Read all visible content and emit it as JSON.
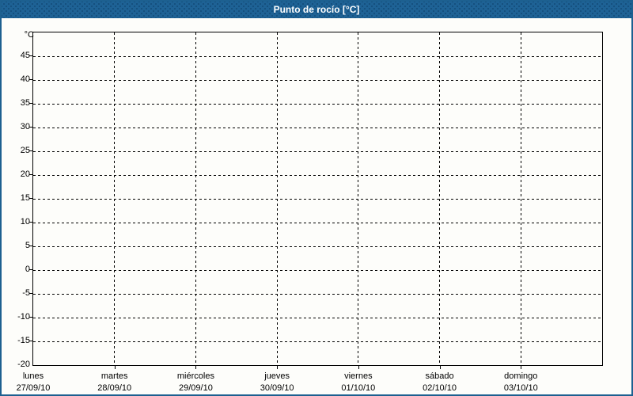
{
  "titlebar": {
    "title": "Punto de rocío [°C]"
  },
  "colors": {
    "titlebar_bg": "#1e6295",
    "titlebar_text": "#ffffff",
    "frame_border": "#1d6090",
    "content_bg": "#fdfdfa",
    "axis": "#000000",
    "grid": "#000000",
    "label_text": "#000000"
  },
  "chart_data": {
    "type": "line",
    "title": "Punto de rocío [°C]",
    "ylabel": "°C",
    "ylim": [
      -20,
      50
    ],
    "yticks": [
      45,
      40,
      35,
      30,
      25,
      20,
      15,
      10,
      5,
      0,
      -5,
      -10,
      -15,
      -20
    ],
    "grid": true,
    "x_days": [
      {
        "name": "lunes",
        "date": "27/09/10"
      },
      {
        "name": "martes",
        "date": "28/09/10"
      },
      {
        "name": "miércoles",
        "date": "29/09/10"
      },
      {
        "name": "jueves",
        "date": "30/09/10"
      },
      {
        "name": "viernes",
        "date": "01/10/10"
      },
      {
        "name": "sábado",
        "date": "02/10/10"
      },
      {
        "name": "domingo",
        "date": "03/10/10"
      }
    ],
    "series": []
  }
}
